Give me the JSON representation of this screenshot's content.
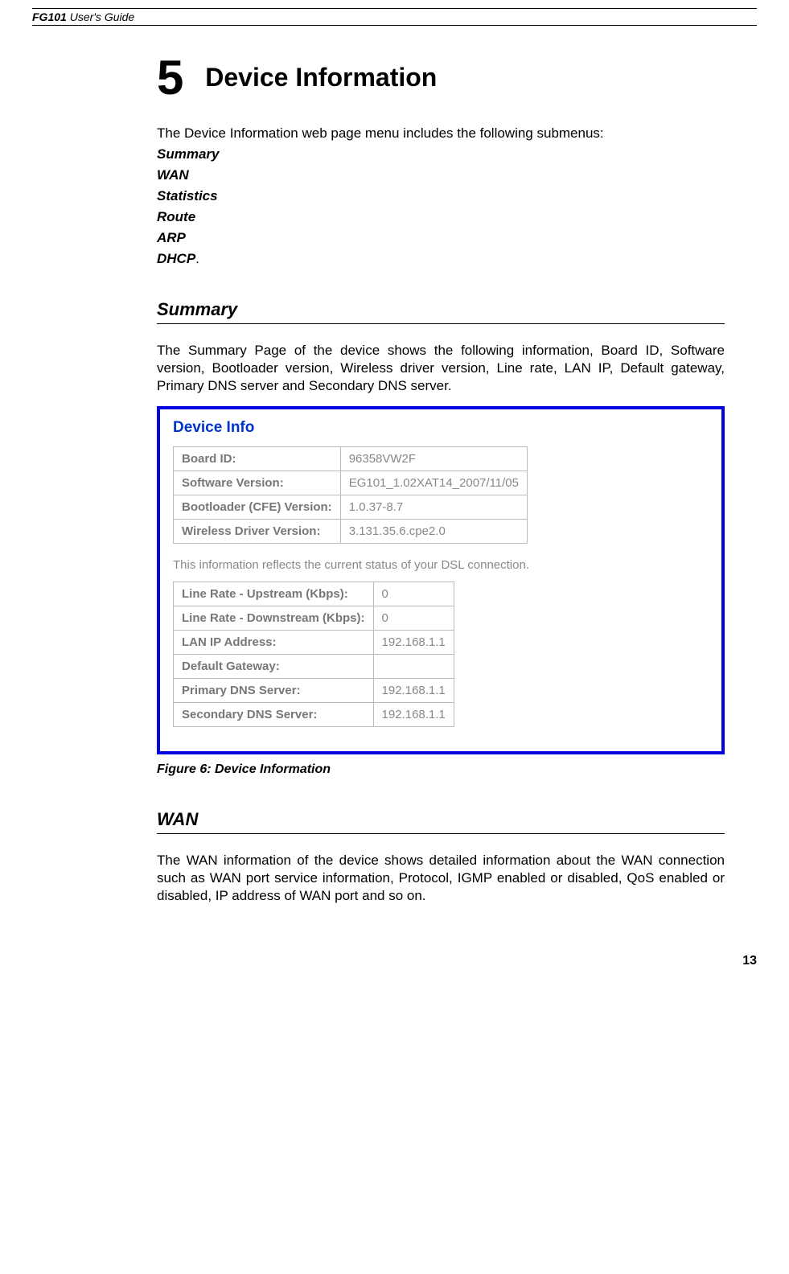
{
  "header": {
    "product": "FG101",
    "guide": " User's Guide"
  },
  "chapter": {
    "number": "5",
    "title": "Device Information"
  },
  "intro": "The Device Information web page menu includes the following submenus:",
  "submenus": [
    "Summary",
    "WAN",
    "Statistics",
    "Route",
    "ARP",
    "DHCP"
  ],
  "sections": {
    "summary": {
      "title": "Summary",
      "text": "The Summary Page of the device shows the following information, Board ID, Software version, Bootloader version, Wireless driver version, Line rate, LAN IP, Default gateway, Primary DNS server and Secondary DNS server."
    },
    "wan": {
      "title": "WAN",
      "text": "The WAN information of the device shows detailed information about the WAN connection such as WAN port service information, Protocol, IGMP enabled or disabled, QoS enabled or disabled, IP address of WAN port and so on."
    }
  },
  "device_info": {
    "title": "Device Info",
    "table1": [
      {
        "label": "Board ID:",
        "value": "96358VW2F"
      },
      {
        "label": "Software Version:",
        "value": "EG101_1.02XAT14_2007/11/05"
      },
      {
        "label": "Bootloader (CFE) Version:",
        "value": "1.0.37-8.7"
      },
      {
        "label": "Wireless Driver Version:",
        "value": "3.131.35.6.cpe2.0"
      }
    ],
    "dsl_note": "This information reflects the current status of your DSL connection.",
    "table2": [
      {
        "label": "Line Rate - Upstream (Kbps):",
        "value": "0"
      },
      {
        "label": "Line Rate - Downstream (Kbps):",
        "value": "0"
      },
      {
        "label": "LAN IP Address:",
        "value": "192.168.1.1"
      },
      {
        "label": "Default Gateway:",
        "value": ""
      },
      {
        "label": "Primary DNS Server:",
        "value": "192.168.1.1"
      },
      {
        "label": "Secondary DNS Server:",
        "value": "192.168.1.1"
      }
    ]
  },
  "figure_caption": "Figure 6: Device Information",
  "page_number": "13"
}
